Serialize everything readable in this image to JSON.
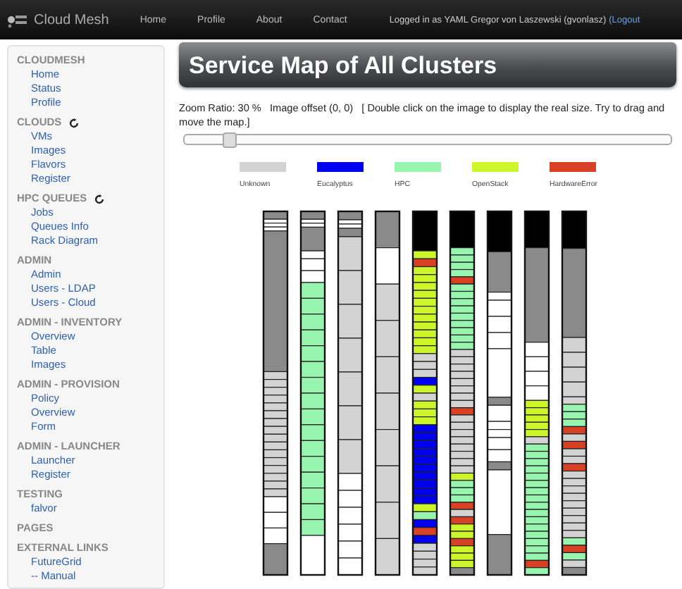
{
  "navbar": {
    "brand": "Cloud Mesh",
    "links": [
      "Home",
      "Profile",
      "About",
      "Contact"
    ],
    "user_text": "Logged in as YAML Gregor von Laszewski (gvonlasz)",
    "logout": "(Logout"
  },
  "sidebar": [
    {
      "title": "CLOUDMESH",
      "loading": false,
      "items": [
        "Home",
        "Status",
        "Profile"
      ]
    },
    {
      "title": "CLOUDS",
      "loading": true,
      "items": [
        "VMs",
        "Images",
        "Flavors",
        "Register"
      ]
    },
    {
      "title": "HPC QUEUES",
      "loading": true,
      "items": [
        "Jobs",
        "Queues Info",
        "Rack Diagram"
      ]
    },
    {
      "title": "ADMIN",
      "loading": false,
      "items": [
        "Admin",
        "Users - LDAP",
        "Users - Cloud"
      ]
    },
    {
      "title": "ADMIN - INVENTORY",
      "loading": false,
      "items": [
        "Overview",
        "Table",
        "Images"
      ]
    },
    {
      "title": "ADMIN - PROVISION",
      "loading": false,
      "items": [
        "Policy",
        "Overview",
        "Form"
      ]
    },
    {
      "title": "ADMIN - LAUNCHER",
      "loading": false,
      "items": [
        "Launcher",
        "Register"
      ]
    },
    {
      "title": "TESTING",
      "loading": false,
      "items": [
        "falvor"
      ]
    },
    {
      "title": "PAGES",
      "loading": false
    },
    {
      "title": "EXTERNAL LINKS",
      "loading": false,
      "items": [
        "FutureGrid",
        "-- Manual"
      ]
    }
  ],
  "page": {
    "title": "Service Map of All Clusters",
    "info": "Zoom Ratio: 30 %   Image offset (0, 0)   [ Double click on the image to display the real size. Try to drag and move the map.]",
    "zoom_slider": {
      "level": 0.09
    },
    "legend": [
      {
        "label": "Unknown",
        "color": "#d3d3d3"
      },
      {
        "label": "Eucalyptus",
        "color": "#0000ee"
      },
      {
        "label": "HPC",
        "color": "#98f5b0"
      },
      {
        "label": "OpenStack",
        "color": "#ccf52a"
      },
      {
        "label": "HardwareError",
        "color": "#d94125"
      }
    ]
  }
}
